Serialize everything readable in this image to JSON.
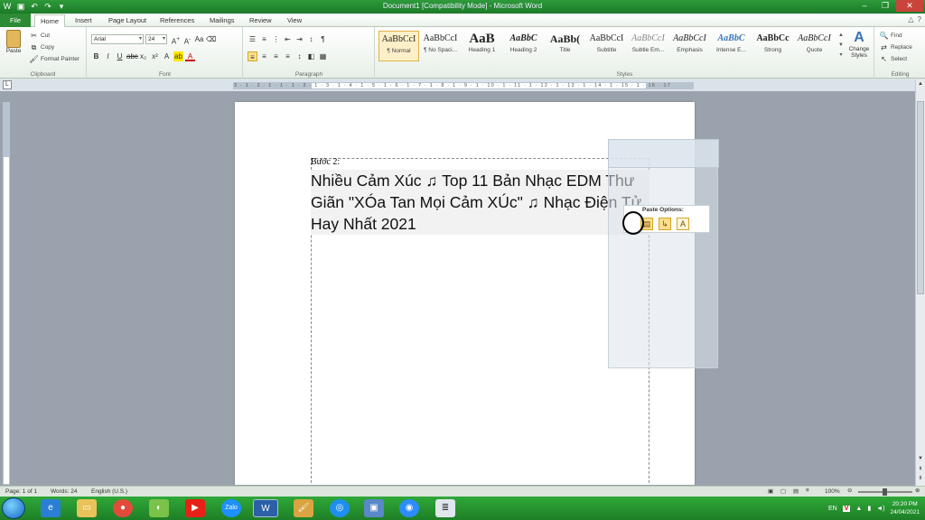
{
  "window": {
    "title": "Document1 [Compatibility Mode] - Microsoft Word"
  },
  "tabs": [
    {
      "label": "File"
    },
    {
      "label": "Home"
    },
    {
      "label": "Insert"
    },
    {
      "label": "Page Layout"
    },
    {
      "label": "References"
    },
    {
      "label": "Mailings"
    },
    {
      "label": "Review"
    },
    {
      "label": "View"
    }
  ],
  "clipboard": {
    "paste": "Paste",
    "cut": "Cut",
    "copy": "Copy",
    "format_painter": "Format Painter",
    "group": "Clipboard"
  },
  "font": {
    "name": "Arial",
    "size": "24",
    "group": "Font"
  },
  "paragraph": {
    "group": "Paragraph"
  },
  "styles": {
    "group": "Styles",
    "items": [
      {
        "sample": "AaBbCcI",
        "name": "¶ Normal"
      },
      {
        "sample": "AaBbCcI",
        "name": "¶ No Spaci..."
      },
      {
        "sample": "AaB",
        "name": "Heading 1"
      },
      {
        "sample": "AaBbC",
        "name": "Heading 2"
      },
      {
        "sample": "AaBb(",
        "name": "Title"
      },
      {
        "sample": "AaBbCcI",
        "name": "Subtitle"
      },
      {
        "sample": "AaBbCcI",
        "name": "Subtle Em..."
      },
      {
        "sample": "AaBbCcI",
        "name": "Emphasis"
      },
      {
        "sample": "AaBbC",
        "name": "Intense E..."
      },
      {
        "sample": "AaBbCc",
        "name": "Strong"
      },
      {
        "sample": "AaBbCcI",
        "name": "Quote"
      }
    ],
    "change_styles": "Change Styles"
  },
  "editing": {
    "find": "Find",
    "replace": "Replace",
    "select": "Select",
    "group": "Editing"
  },
  "ruler": {
    "ticks": "3 · 1 · 2 · 1 · 1 · 1 · 2 · 1 · 3 · 1 · 4 · 1 · 5 · 1 · 6 · 1 · 7 · 1 · 8 · 1 · 9 · 1 · 10 · 1 · 11 · 1 · 12 · 1 · 13 · 1 · 14 · 1 · 15 · 1 · 16 · 17"
  },
  "document": {
    "step_label": "Bước 2:",
    "pasted_text": "Nhiều Cảm Xúc ♫ Top 11 Bản Nhạc EDM Thư Giãn \"XÓa Tan Mọi Cảm XÚc\" ♫ Nhạc Điện Tử Hay Nhất 2021"
  },
  "paste_options": {
    "label": "Paste Options:"
  },
  "status": {
    "page": "Page: 1 of 1",
    "words": "Words: 24",
    "language": "English (U.S.)",
    "zoom": "100%"
  },
  "taskbar": {
    "lang": "EN",
    "time": "20:20 PM",
    "date": "24/04/2021"
  }
}
